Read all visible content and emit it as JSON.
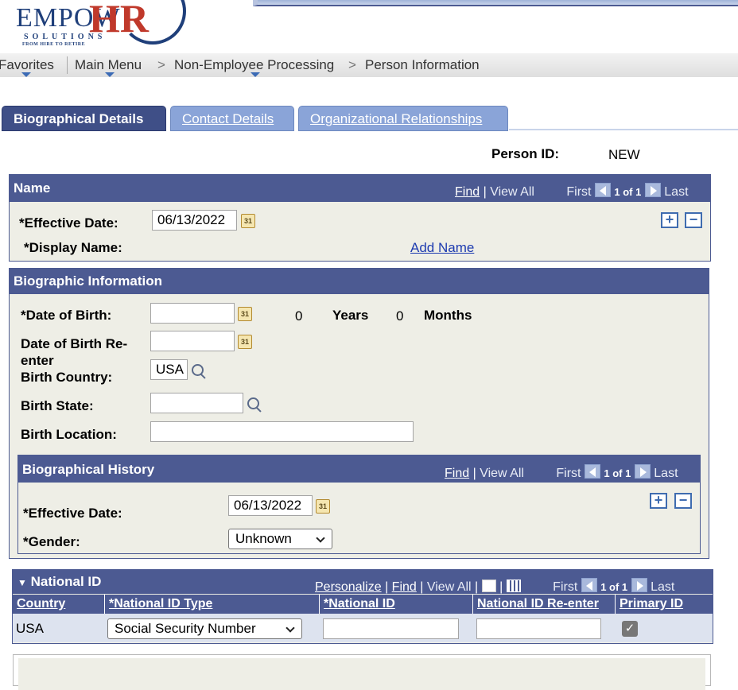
{
  "logo": {
    "brand_main": "EMPOW",
    "brand_hr": "HR",
    "brand_sub": "SOLUTIONS",
    "brand_tagline": "FROM HIRE TO RETIRE"
  },
  "nav": {
    "favorites": "Favorites",
    "main_menu": "Main Menu",
    "crumb_1": "Non-Employee Processing",
    "crumb_2": "Person Information",
    "separator": ">"
  },
  "tabs": {
    "biographical": "Biographical Details",
    "contact": "Contact Details",
    "org": "Organizational Relationships"
  },
  "person": {
    "label": "Person ID:",
    "value": "NEW"
  },
  "name_section": {
    "title": "Name",
    "find": "Find",
    "view_all": "View All",
    "first": "First",
    "count": "1 of 1",
    "last": "Last",
    "effective_date_label": "*Effective Date:",
    "effective_date_value": "06/13/2022",
    "display_name_label": "*Display Name:",
    "add_name": "Add Name"
  },
  "bio_section": {
    "title": "Biographic Information",
    "dob_label": "*Date of Birth:",
    "dob_value": "",
    "years_value": "0",
    "years_label": "Years",
    "months_value": "0",
    "months_label": "Months",
    "dob_reenter_label_1": "Date of Birth Re-",
    "dob_reenter_label_2": "enter",
    "dob_reenter_value": "",
    "birth_country_label": "Birth Country:",
    "birth_country_value": "USA",
    "birth_state_label": "Birth State:",
    "birth_state_value": "",
    "birth_location_label": "Birth Location:",
    "birth_location_value": ""
  },
  "bio_history": {
    "title": "Biographical History",
    "find": "Find",
    "view_all": "View All",
    "first": "First",
    "count": "1 of 1",
    "last": "Last",
    "effective_date_label": "*Effective Date:",
    "effective_date_value": "06/13/2022",
    "gender_label": "*Gender:",
    "gender_value": "Unknown"
  },
  "national_id": {
    "title": "National ID",
    "personalize": "Personalize",
    "find": "Find",
    "view_all": "View All",
    "first": "First",
    "count": "1 of 1",
    "last": "Last",
    "columns": [
      "Country",
      "*National ID Type",
      "*National ID",
      "National ID Re-enter",
      "Primary ID"
    ],
    "row": {
      "country": "USA",
      "id_type": "Social Security Number",
      "national_id": "",
      "national_id_reenter": "",
      "primary_checked": true
    }
  },
  "icons": {
    "calendar": "31",
    "plus": "+",
    "minus": "−",
    "check": "✓"
  }
}
